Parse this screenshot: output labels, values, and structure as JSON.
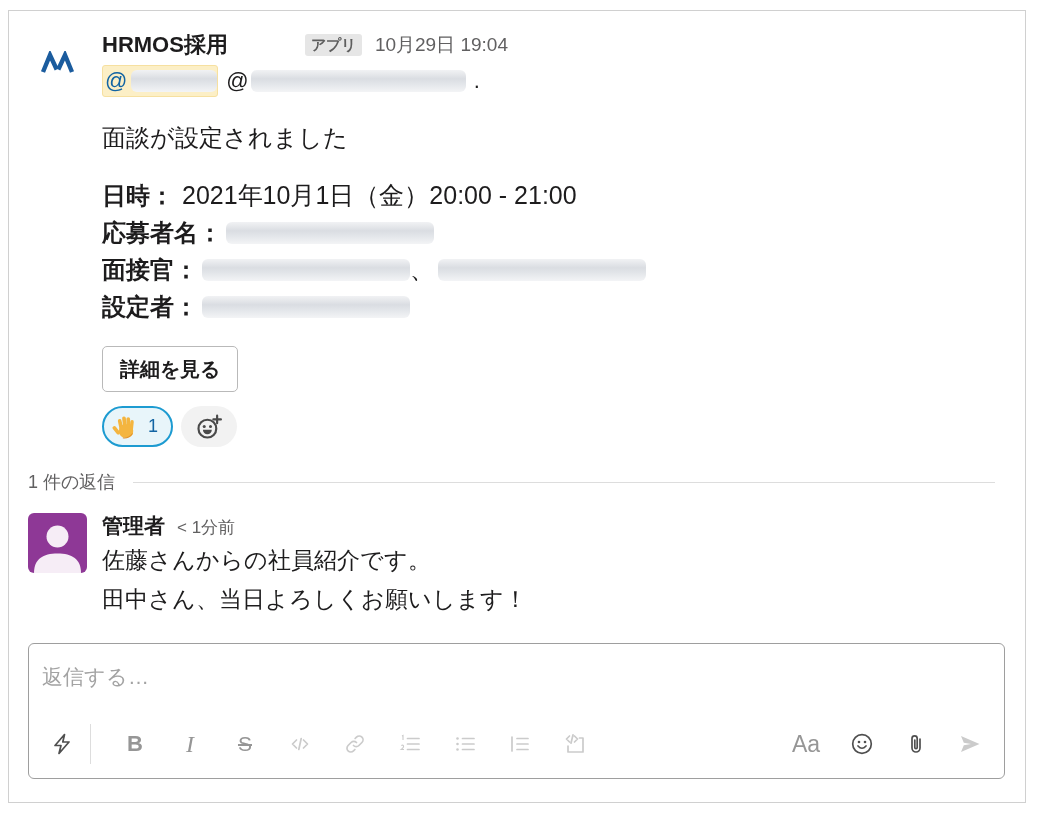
{
  "message": {
    "sender": "HRMOS採用",
    "badge": "アプリ",
    "timestamp": "10月29日 19:04",
    "mention_line": [
      {
        "kind": "mention",
        "text": "@",
        "highlighted": true
      },
      {
        "kind": "mention",
        "text": "@",
        "highlighted": false
      },
      {
        "kind": "text",
        "text": "."
      }
    ],
    "text": "面談が設定されました",
    "fields": [
      {
        "label": "日時：",
        "parts": [
          {
            "kind": "text",
            "text": "2021年10月1日（金）20:00 - 21:00"
          }
        ]
      },
      {
        "label": "応募者名：",
        "parts": [
          {
            "kind": "redacted"
          }
        ]
      },
      {
        "label": "面接官：",
        "parts": [
          {
            "kind": "redacted"
          },
          {
            "kind": "text",
            "text": "、"
          },
          {
            "kind": "redacted"
          }
        ]
      },
      {
        "label": "設定者：",
        "parts": [
          {
            "kind": "redacted"
          }
        ]
      }
    ],
    "button": "詳細を見る",
    "reactions": [
      {
        "count": "1",
        "selected": true
      }
    ]
  },
  "thread": {
    "reply_count": "1 件の返信",
    "replies": [
      {
        "author": "管理者",
        "time": "< 1分前",
        "lines": [
          "佐藤さんからの社員紹介です。",
          "田中さん、当日よろしくお願いします！"
        ]
      }
    ]
  },
  "composer": {
    "placeholder": "返信する…",
    "left_tools": [
      {
        "kind": "shortcuts",
        "disabled": false
      }
    ],
    "format_tools": [
      {
        "kind": "bold",
        "glyph": "B",
        "disabled": true
      },
      {
        "kind": "italic",
        "glyph": "I",
        "disabled": true
      },
      {
        "kind": "strike",
        "glyph": "S",
        "disabled": true
      },
      {
        "kind": "code",
        "disabled": true
      },
      {
        "kind": "link",
        "disabled": true
      },
      {
        "kind": "ordered_list",
        "disabled": true
      },
      {
        "kind": "bullet_list",
        "disabled": true
      },
      {
        "kind": "blockquote",
        "disabled": true
      },
      {
        "kind": "code_block",
        "disabled": true
      }
    ],
    "right_tools": [
      {
        "kind": "text_format",
        "glyph": "Aa",
        "disabled": true
      },
      {
        "kind": "emoji",
        "disabled": false
      },
      {
        "kind": "attach",
        "disabled": false
      },
      {
        "kind": "send",
        "disabled": true
      }
    ]
  }
}
